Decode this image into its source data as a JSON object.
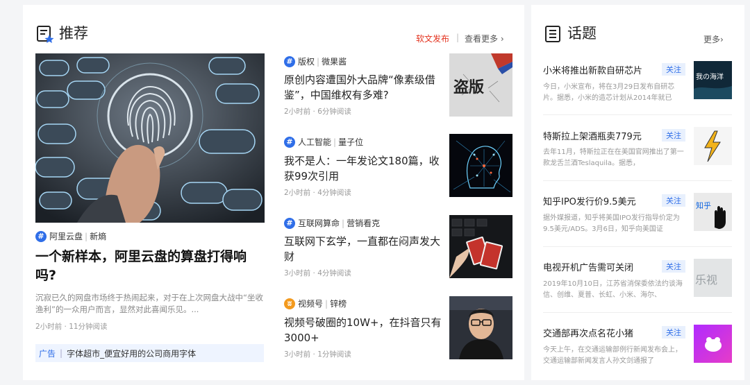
{
  "recommend": {
    "title": "推荐",
    "soft_publish": "软文发布",
    "divider": "|",
    "see_more": "查看更多 ›"
  },
  "hero": {
    "tag": "阿里云盘",
    "source": "新熵",
    "title": "一个新样本，阿里云盘的算盘打得响吗?",
    "desc": "沉寂已久的网盘市场终于热闹起来，对于在上次网盘大战中“坐收渔利”的一众用户而言，显然对此喜闻乐见。...",
    "meta": "2小时前 · 11分钟阅读"
  },
  "ad": {
    "label": "广告",
    "text": "字体超市_便宜好用的公司商用字体"
  },
  "articles": [
    {
      "tag": "版权",
      "source": "微果酱",
      "title": "原创内容遭国外大品牌“像素级借鉴”，中国维权有多难?",
      "meta": "2小时前 · 6分钟阅读",
      "icon": "hash-icon"
    },
    {
      "tag": "人工智能",
      "source": "量子位",
      "title": "我不是人：一年发论文180篇，收获99次引用",
      "meta": "2小时前 · 4分钟阅读",
      "icon": "hash-icon"
    },
    {
      "tag": "互联网算命",
      "source": "营销看克",
      "title": "互联网下玄学，一直都在闷声发大财",
      "meta": "3小时前 · 4分钟阅读",
      "icon": "hash-icon"
    },
    {
      "tag": "视频号",
      "source": "锌榜",
      "title": "视频号破圈的10W+，在抖音只有3000+",
      "meta": "3小时前 · 1分钟阅读",
      "icon": "channels-icon"
    }
  ],
  "topics": {
    "title": "话题",
    "more": "更多›",
    "follow_label": "关注",
    "items": [
      {
        "title": "小米将推出新款自研芯片",
        "desc": "今日，小米宣布，将在3月29日发布自研芯片。据悉，小米的造芯计划从2014年就已"
      },
      {
        "title": "特斯拉上架酒瓶卖779元",
        "desc": "去年11月，特斯拉正在在美国官网推出了第一款龙舌兰酒Teslaquila。据悉，"
      },
      {
        "title": "知乎IPO发行价9.5美元",
        "desc": "据外媒报道，知乎将美国IPO发行指导价定为9.5美元/ADS。3月6日，知乎向美国证"
      },
      {
        "title": "电视开机广告需可关闭",
        "desc": "2019年10月10日，江苏省消保委依法约谈海信、创维、夏普、长虹、小米、海尔、"
      },
      {
        "title": "交通部再次点名花小猪",
        "desc": "今天上午，在交通运输部例行新闻发布会上，交通运输部新闻发言人孙文剑通报了"
      }
    ]
  },
  "thumb_text": {
    "dao_ban": "盗版",
    "zhihu": "知乎",
    "lecheng": "乐视",
    "haixiao": "我の海洋"
  },
  "colors": {
    "accent_blue": "#2f6ee8",
    "accent_red": "#e3321e",
    "channels_orange": "#f39a1e"
  }
}
